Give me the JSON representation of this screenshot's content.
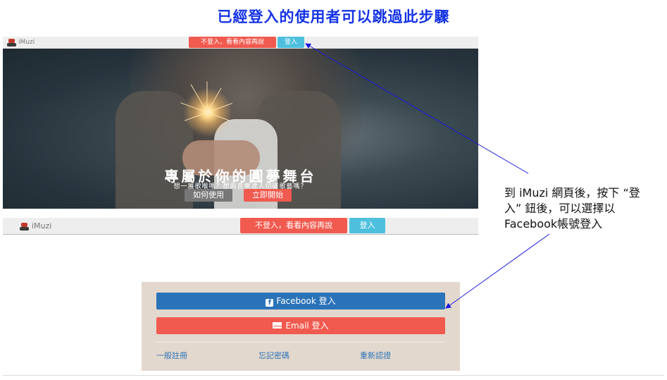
{
  "headline": "已經登入的使用者可以跳過此步驟",
  "top_bar": {
    "brand": "iMuzi",
    "browse_button": "不登入，看看內容再說",
    "login_button": "登入"
  },
  "hero": {
    "title": "專屬於你的圓夢舞台",
    "subtitle": "想一展歌喉嗎？想與音樂達人切磋歌藝嗎？",
    "howto_button": "如何使用",
    "start_button": "立即開始"
  },
  "second_bar": {
    "brand": "iMuzi",
    "browse_button": "不登入，看看內容再說",
    "login_button": "登入"
  },
  "login_panel": {
    "facebook_button": "Facebook 登入",
    "email_button": "Email 登入",
    "register_link": "一般註冊",
    "forgot_link": "忘記密碼",
    "verify_link": "重新認證"
  },
  "annotation": {
    "line1": "到 iMuzi 網頁後，按下 “登",
    "line2": "入” 鈕後，可以選擇以",
    "line3": "Facebook帳號登入"
  },
  "icons": [
    "robot-logo-icon",
    "facebook-icon",
    "envelope-icon"
  ],
  "colors": {
    "headline": "#1432e6",
    "red_button": "#f05a4f",
    "blue_button": "#4ec0de",
    "facebook": "#2b73b9",
    "panel_bg": "#e3d8cd",
    "arrow": "#1a1adc"
  }
}
